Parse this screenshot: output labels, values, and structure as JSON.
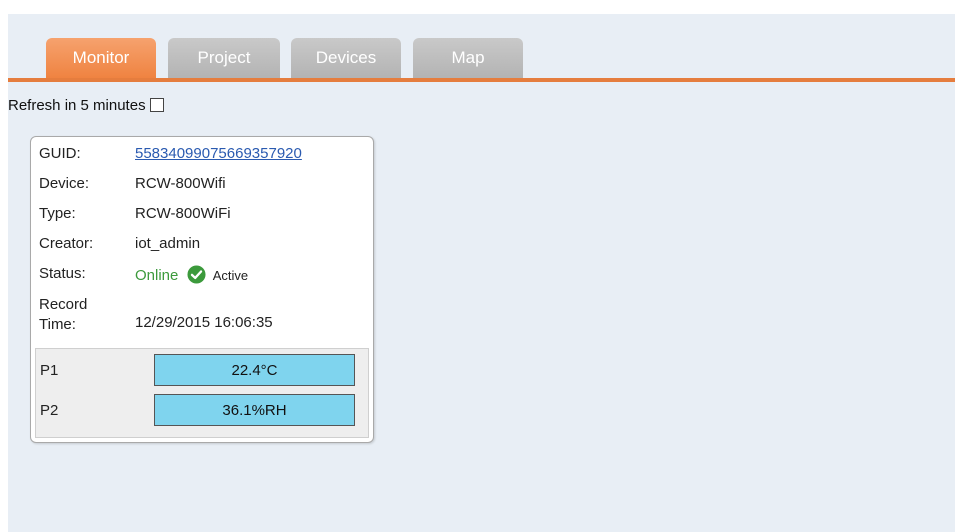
{
  "tabs": [
    {
      "label": "Monitor",
      "active": true
    },
    {
      "label": "Project",
      "active": false
    },
    {
      "label": "Devices",
      "active": false
    },
    {
      "label": "Map",
      "active": false
    }
  ],
  "refresh": {
    "label": "Refresh in 5 minutes",
    "checked": false
  },
  "device": {
    "guid_label": "GUID:",
    "guid": "55834099075669357920",
    "device_label": "Device:",
    "device": "RCW-800Wifi",
    "type_label": "Type:",
    "type": "RCW-800WiFi",
    "creator_label": "Creator:",
    "creator": "iot_admin",
    "status_label": "Status:",
    "status": "Online",
    "status_badge": "Active",
    "record_time_label_1": "Record",
    "record_time_label_2": "Time:",
    "record_time": "12/29/2015 16:06:35"
  },
  "sensors": [
    {
      "label": "P1",
      "value": "22.4°C"
    },
    {
      "label": "P2",
      "value": "36.1%RH"
    }
  ],
  "colors": {
    "accent": "#ef8341",
    "online": "#3c9a3c",
    "sensor_fill": "#7fd4ee"
  },
  "icons": {
    "status": "check-circle-icon"
  }
}
